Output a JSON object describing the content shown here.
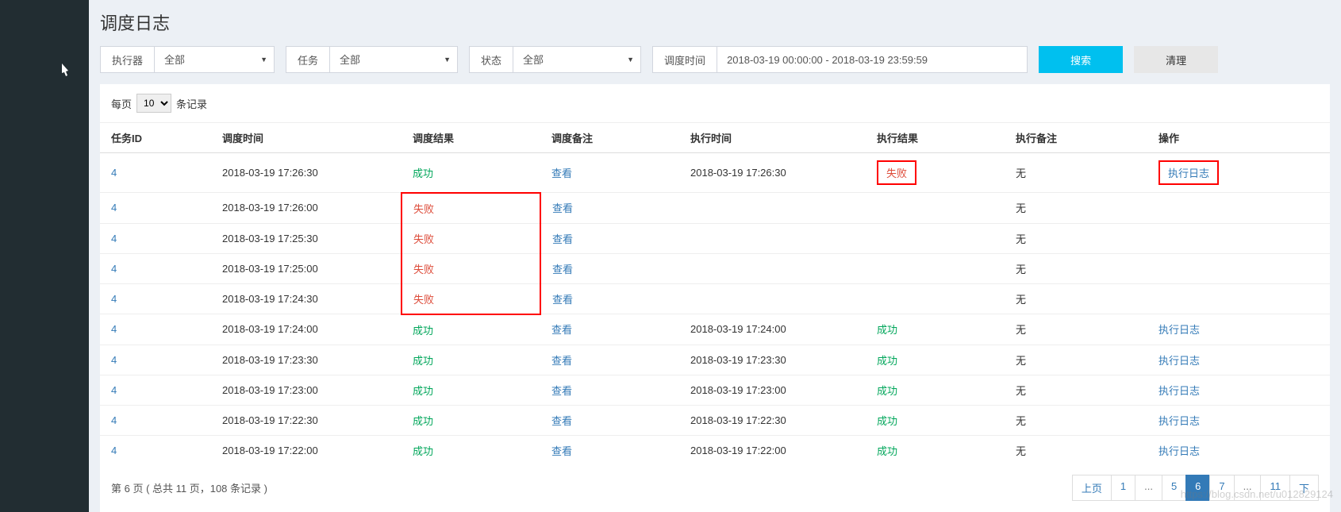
{
  "title": "调度日志",
  "filters": {
    "executor": {
      "label": "执行器",
      "value": "全部"
    },
    "task": {
      "label": "任务",
      "value": "全部"
    },
    "status": {
      "label": "状态",
      "value": "全部"
    },
    "time": {
      "label": "调度时间",
      "value": "2018-03-19 00:00:00 - 2018-03-19 23:59:59"
    }
  },
  "buttons": {
    "search": "搜索",
    "clear": "清理"
  },
  "length": {
    "prefix": "每页",
    "value": "10",
    "suffix": "条记录"
  },
  "columns": {
    "taskId": "任务ID",
    "dispatchTime": "调度时间",
    "dispatchResult": "调度结果",
    "dispatchNote": "调度备注",
    "execTime": "执行时间",
    "execResult": "执行结果",
    "execNote": "执行备注",
    "op": "操作"
  },
  "labels": {
    "success": "成功",
    "fail": "失败",
    "view": "查看",
    "none": "无",
    "execLog": "执行日志"
  },
  "rows": [
    {
      "taskId": "4",
      "dispatchTime": "2018-03-19 17:26:30",
      "dispatchResult": "success",
      "execTime": "2018-03-19 17:26:30",
      "execResult": "fail",
      "execResultHl": true,
      "opHl": true,
      "hasOp": true
    },
    {
      "taskId": "4",
      "dispatchTime": "2018-03-19 17:26:00",
      "dispatchResult": "fail",
      "dispatchHl": "top",
      "execTime": "",
      "execResult": "",
      "hasOp": false
    },
    {
      "taskId": "4",
      "dispatchTime": "2018-03-19 17:25:30",
      "dispatchResult": "fail",
      "dispatchHl": "mid",
      "execTime": "",
      "execResult": "",
      "hasOp": false
    },
    {
      "taskId": "4",
      "dispatchTime": "2018-03-19 17:25:00",
      "dispatchResult": "fail",
      "dispatchHl": "mid",
      "execTime": "",
      "execResult": "",
      "hasOp": false
    },
    {
      "taskId": "4",
      "dispatchTime": "2018-03-19 17:24:30",
      "dispatchResult": "fail",
      "dispatchHl": "bottom",
      "execTime": "",
      "execResult": "",
      "hasOp": false
    },
    {
      "taskId": "4",
      "dispatchTime": "2018-03-19 17:24:00",
      "dispatchResult": "success",
      "execTime": "2018-03-19 17:24:00",
      "execResult": "success",
      "hasOp": true
    },
    {
      "taskId": "4",
      "dispatchTime": "2018-03-19 17:23:30",
      "dispatchResult": "success",
      "execTime": "2018-03-19 17:23:30",
      "execResult": "success",
      "hasOp": true
    },
    {
      "taskId": "4",
      "dispatchTime": "2018-03-19 17:23:00",
      "dispatchResult": "success",
      "execTime": "2018-03-19 17:23:00",
      "execResult": "success",
      "hasOp": true
    },
    {
      "taskId": "4",
      "dispatchTime": "2018-03-19 17:22:30",
      "dispatchResult": "success",
      "execTime": "2018-03-19 17:22:30",
      "execResult": "success",
      "hasOp": true
    },
    {
      "taskId": "4",
      "dispatchTime": "2018-03-19 17:22:00",
      "dispatchResult": "success",
      "execTime": "2018-03-19 17:22:00",
      "execResult": "success",
      "hasOp": true
    }
  ],
  "pageInfo": "第 6 页 ( 总共 11 页，108 条记录 )",
  "pagination": {
    "prev": "上页",
    "next": "下",
    "pages": [
      "1",
      "...",
      "5",
      "6",
      "7",
      "...",
      "11"
    ],
    "active": "6"
  },
  "watermark": "https://blog.csdn.net/u012829124"
}
